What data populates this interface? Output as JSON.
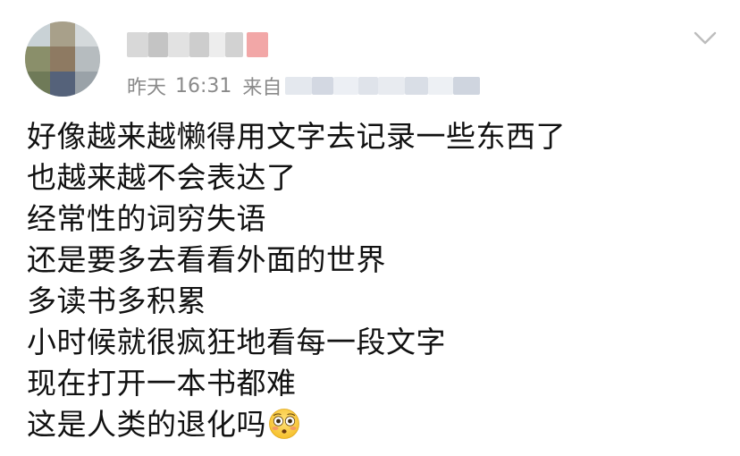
{
  "post": {
    "meta": {
      "day": "昨天",
      "time": "16:31",
      "from_label": "来自"
    },
    "lines": [
      "好像越来越懒得用文字去记录一些东西了",
      "也越来越不会表达了",
      "经常性的词穷失语",
      "还是要多去看看外面的世界",
      "多读书多积累",
      "小时候就很疯狂地看每一段文字",
      "现在打开一本书都难",
      "这是人类的退化吗"
    ],
    "emoji": "flushed-face",
    "icons": {
      "menu": "chevron-down-icon"
    }
  },
  "colors": {
    "text": "#111111",
    "meta": "#8a8a8a",
    "chevron": "#bdbdbd"
  }
}
